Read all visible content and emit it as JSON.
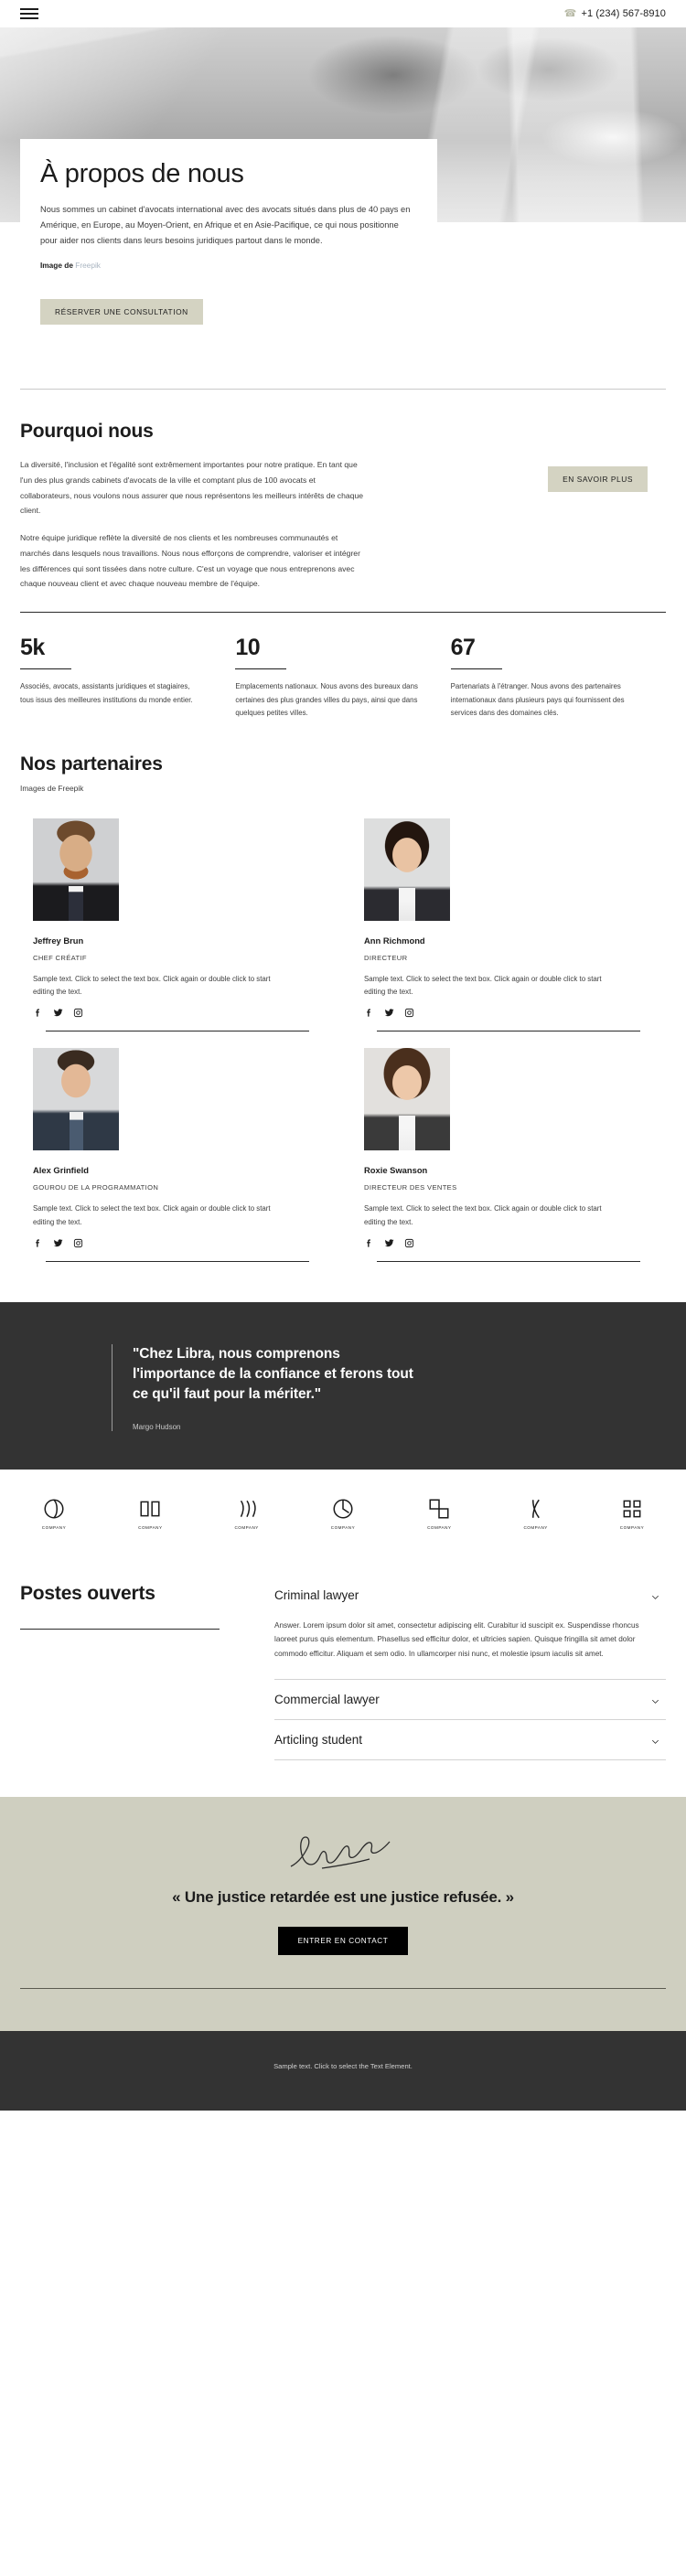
{
  "header": {
    "menu_icon": "hamburger-menu-icon",
    "phone_icon": "phone-icon",
    "phone": "+1 (234) 567-8910"
  },
  "hero": {
    "title": "À propos de nous",
    "paragraph": "Nous sommes un cabinet d'avocats international avec des avocats situés dans plus de 40 pays en Amérique, en Europe, au Moyen-Orient, en Afrique et en Asie-Pacifique, ce qui nous positionne pour aider nos clients dans leurs besoins juridiques partout dans le monde.",
    "credit_label": "Image de ",
    "credit_link": "Freepik",
    "cta_button": "RÉSERVER UNE CONSULTATION"
  },
  "why": {
    "title": "Pourquoi nous",
    "paragraph1": "La diversité, l'inclusion et l'égalité sont extrêmement importantes pour notre pratique. En tant que l'un des plus grands cabinets d'avocats de la ville et comptant plus de 100 avocats et collaborateurs, nous voulons nous assurer que nous représentons les meilleurs intérêts de chaque client.",
    "paragraph2": "Notre équipe juridique reflète la diversité de nos clients et les nombreuses communautés et marchés dans lesquels nous travaillons. Nous nous efforçons de comprendre, valoriser et intégrer les différences qui sont tissées dans notre culture. C'est un voyage que nous entreprenons avec chaque nouveau client et avec chaque nouveau membre de l'équipe.",
    "button": "EN SAVOIR PLUS"
  },
  "stats": [
    {
      "number": "5k",
      "text": "Associés, avocats, assistants juridiques et stagiaires, tous issus des meilleures institutions du monde entier."
    },
    {
      "number": "10",
      "text": "Emplacements nationaux. Nous avons des bureaux dans certaines des plus grandes villes du pays, ainsi que dans quelques petites villes."
    },
    {
      "number": "67",
      "text": "Partenariats à l'étranger. Nous avons des partenaires internationaux dans plusieurs pays qui fournissent des services dans des domaines clés."
    }
  ],
  "partners": {
    "title": "Nos partenaires",
    "subtitle": "Images de Freepik",
    "members": [
      {
        "name": "Jeffrey Brun",
        "role": "CHEF CRÉATIF",
        "bio": "Sample text. Click to select the text box. Click again or double click to start editing the text."
      },
      {
        "name": "Ann Richmond",
        "role": "DIRECTEUR",
        "bio": "Sample text. Click to select the text box. Click again or double click to start editing the text."
      },
      {
        "name": "Alex Grinfield",
        "role": "GOUROU DE LA PROGRAMMATION",
        "bio": "Sample text. Click to select the text box. Click again or double click to start editing the text."
      },
      {
        "name": "Roxie Swanson",
        "role": "DIRECTEUR DES VENTES",
        "bio": "Sample text. Click to select the text box. Click again or double click to start editing the text."
      }
    ],
    "social_icons": [
      "facebook-icon",
      "twitter-icon",
      "instagram-icon"
    ]
  },
  "quote": {
    "text": "\"Chez Libra, nous comprenons l'importance de la confiance et ferons tout ce qu'il faut pour la mériter.\"",
    "author": "Margo Hudson"
  },
  "logos": [
    {
      "caption": "COMPANY",
      "icon": "circle-swirl-logo-icon"
    },
    {
      "caption": "COMPANY",
      "icon": "open-book-logo-icon"
    },
    {
      "caption": "COMPANY",
      "icon": "flame-lines-logo-icon"
    },
    {
      "caption": "COMPANY",
      "icon": "circle-leaf-logo-icon"
    },
    {
      "caption": "COMPANY",
      "icon": "squares-logo-icon"
    },
    {
      "caption": "COMPANY",
      "icon": "double-leaf-logo-icon"
    },
    {
      "caption": "COMPANY",
      "icon": "brackets-logo-icon"
    }
  ],
  "jobs": {
    "title": "Postes ouverts",
    "items": [
      {
        "title": "Criminal lawyer",
        "expanded": true,
        "body": "Answer. Lorem ipsum dolor sit amet, consectetur adipiscing elit. Curabitur id suscipit ex. Suspendisse rhoncus laoreet purus quis elementum. Phasellus sed efficitur dolor, et ultricies sapien. Quisque fringilla sit amet dolor commodo efficitur. Aliquam et sem odio. In ullamcorper nisi nunc, et molestie ipsum iaculis sit amet."
      },
      {
        "title": "Commercial lawyer",
        "expanded": false,
        "body": ""
      },
      {
        "title": "Articling student",
        "expanded": false,
        "body": ""
      }
    ],
    "chevron_icon": "chevron-down-icon"
  },
  "cta": {
    "signature_icon": "handwritten-signature-icon",
    "quote": "« Une justice retardée est une justice refusée. »",
    "button": "ENTRER EN CONTACT"
  },
  "footer": {
    "text": "Sample text. Click to select the Text Element."
  },
  "colors": {
    "tan_button": "#d4d3c2",
    "dark_band": "#333333",
    "cta_background": "#cfcfc0",
    "link": "#a9b4c0"
  }
}
